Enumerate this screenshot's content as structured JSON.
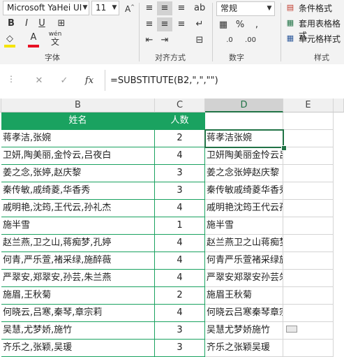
{
  "ribbon": {
    "font_name": "Microsoft YaHei UI",
    "font_size": "11",
    "number_format": "常规",
    "cond_format": "条件格式",
    "table_format": "套用表格格式",
    "cell_style": "单元格样式",
    "phonetic_top": "wén",
    "phonetic_bottom": "文",
    "groups": {
      "font": "字体",
      "align": "对齐方式",
      "number": "数字",
      "style": "样式"
    }
  },
  "formula_bar": {
    "formula": "=SUBSTITUTE(B2,\",\",\"\")",
    "fx": "fx"
  },
  "columns": [
    "B",
    "C",
    "D",
    "E"
  ],
  "table": {
    "headers": [
      "姓名",
      "人数"
    ],
    "rows": [
      {
        "names": "蒋孝洁,张婉",
        "count": "2",
        "result": "蒋孝洁张婉"
      },
      {
        "names": "卫妍,陶美丽,金怜云,吕夜白",
        "count": "4",
        "result": "卫妍陶美丽金怜云吕夜白"
      },
      {
        "names": "姜之念,张婷,赵庆黎",
        "count": "3",
        "result": "姜之念张婷赵庆黎"
      },
      {
        "names": "秦传敏,戚绮菱,华香秀",
        "count": "3",
        "result": "秦传敏戚绮菱华香秀"
      },
      {
        "names": "戚明艳,沈筠,王代云,孙礼杰",
        "count": "4",
        "result": "戚明艳沈筠王代云孙礼杰"
      },
      {
        "names": "施半雪",
        "count": "1",
        "result": "施半雪"
      },
      {
        "names": "赵兰燕,卫之山,蒋痴梦,孔婷",
        "count": "4",
        "result": "赵兰燕卫之山蒋痴梦孔婷"
      },
      {
        "names": "何青,严乐萱,褚采绿,施醉薇",
        "count": "4",
        "result": "何青严乐萱褚采绿施醉薇"
      },
      {
        "names": "严翠安,郑翠安,孙芸,朱兰燕",
        "count": "4",
        "result": "严翠安郑翠安孙芸朱兰燕"
      },
      {
        "names": "施眉,王秋菊",
        "count": "2",
        "result": "施眉王秋菊"
      },
      {
        "names": "何晓云,吕寒,秦琴,章宗莉",
        "count": "4",
        "result": "何晓云吕寒秦琴章宗莉"
      },
      {
        "names": "吴慧,尤梦娇,施竹",
        "count": "3",
        "result": "吴慧尤梦娇施竹"
      },
      {
        "names": "齐乐之,张颖,吴瑗",
        "count": "3",
        "result": "齐乐之张颖吴瑗"
      }
    ]
  },
  "colors": {
    "header_green": "#1aa260",
    "selection": "#217346"
  }
}
